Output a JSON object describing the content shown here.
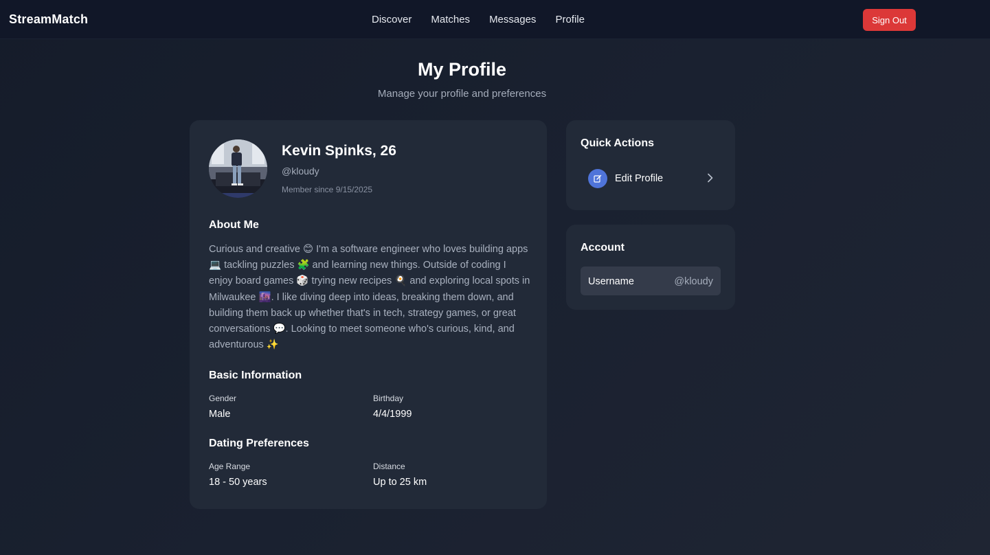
{
  "app": {
    "brand": "StreamMatch"
  },
  "nav": {
    "items": [
      {
        "label": "Discover"
      },
      {
        "label": "Matches"
      },
      {
        "label": "Messages"
      },
      {
        "label": "Profile"
      }
    ],
    "signout_label": "Sign Out"
  },
  "page": {
    "title": "My Profile",
    "subtitle": "Manage your profile and preferences"
  },
  "profile": {
    "name_age": "Kevin Spinks, 26",
    "handle": "@kloudy",
    "member_since": "Member since 9/15/2025",
    "about_title": "About Me",
    "about_text": "Curious and creative 😊 I'm a software engineer who loves building apps 💻 tackling puzzles 🧩 and learning new things. Outside of coding I enjoy board games 🎲 trying new recipes 🍳 and exploring local spots in Milwaukee 🌆. I like diving deep into ideas, breaking them down, and building them back up whether that's in tech, strategy games, or great conversations 💬. Looking to meet someone who's curious, kind, and adventurous ✨",
    "basic_title": "Basic Information",
    "gender_label": "Gender",
    "gender_value": "Male",
    "birthday_label": "Birthday",
    "birthday_value": "4/4/1999",
    "prefs_title": "Dating Preferences",
    "age_range_label": "Age Range",
    "age_range_value": "18 - 50 years",
    "distance_label": "Distance",
    "distance_value": "Up to 25 km"
  },
  "quick_actions": {
    "title": "Quick Actions",
    "edit_profile_label": "Edit Profile",
    "edit_icon": "edit-pencil-icon",
    "chevron_icon": "chevron-right-icon"
  },
  "account": {
    "title": "Account",
    "username_label": "Username",
    "username_value": "@kloudy"
  },
  "colors": {
    "accent_blue": "#4f74d9",
    "signout_red": "#dc3838",
    "card_bg": "#222a38",
    "nav_bg": "#111728"
  }
}
